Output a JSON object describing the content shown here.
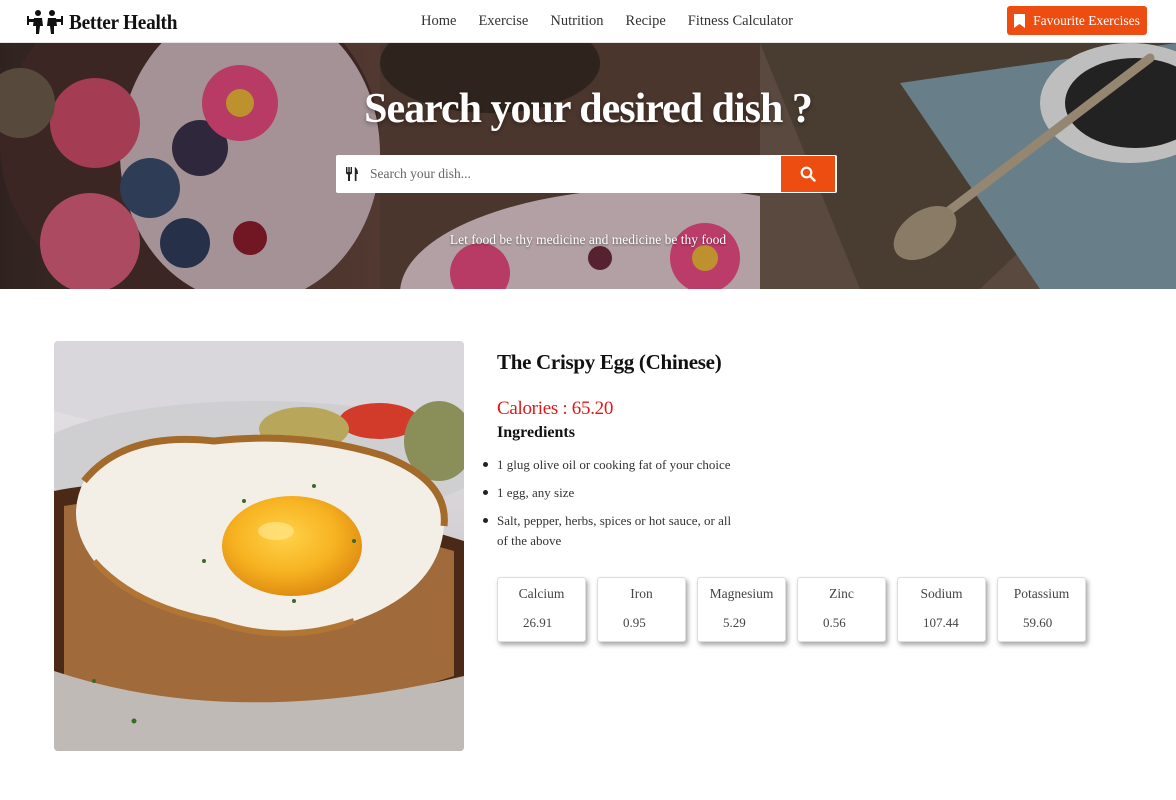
{
  "navbar": {
    "brand_name": "Better Health",
    "links": [
      "Home",
      "Exercise",
      "Nutrition",
      "Recipe",
      "Fitness Calculator"
    ],
    "favourite_button": "Favourite Exercises",
    "accent_color": "#ee4d12"
  },
  "hero": {
    "title": "Search your desired dish ?",
    "search_placeholder": "Search your dish...",
    "quote": "Let food be thy medicine and medicine be thy food"
  },
  "dish": {
    "title": "The Crispy Egg (Chinese)",
    "calories": "Calories : 65.20",
    "ingredients_heading": "Ingredients",
    "ingredients": [
      "1 glug olive oil or cooking fat of your choice",
      "1 egg, any size",
      "Salt, pepper, herbs, spices or hot sauce, or all of the above"
    ],
    "nutrients": [
      {
        "name": "Calcium",
        "value": "26.91"
      },
      {
        "name": "Iron",
        "value": "0.95"
      },
      {
        "name": "Magnesium",
        "value": "5.29"
      },
      {
        "name": "Zinc",
        "value": "0.56"
      },
      {
        "name": "Sodium",
        "value": "107.44"
      },
      {
        "name": "Potassium",
        "value": "59.60"
      }
    ]
  }
}
